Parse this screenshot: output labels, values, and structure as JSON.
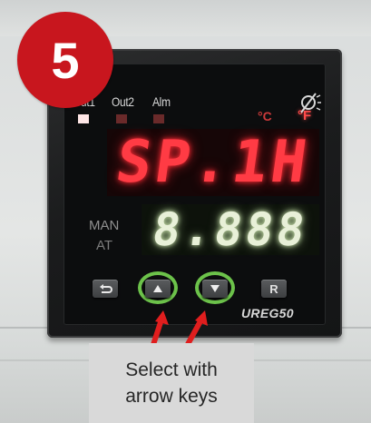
{
  "step_badge": {
    "number": "5",
    "color": "#c8161e"
  },
  "controller": {
    "indicators": [
      "Out1",
      "Out2",
      "Alm"
    ],
    "indicator_led_colors": [
      "#ffe6e6",
      "#6a2a2a",
      "#6a2a2a"
    ],
    "unit_celsius": "°C",
    "unit_fahrenheit": "°F",
    "pv_display": "SP.1H",
    "sv_display": "8.888",
    "mode_labels": {
      "man": "MAN",
      "at": "AT"
    },
    "keys": {
      "cycle_icon": "cycle-arrows-icon",
      "up_icon": "triangle-up-icon",
      "down_icon": "triangle-down-icon",
      "r_label": "R"
    },
    "brand": "UREG50",
    "logo_icon": "lightbulb-slash-icon",
    "highlight_color": "#6cc24a"
  },
  "annotation": {
    "text": "Select with\narrow keys",
    "arrow_color": "#e01e1e"
  }
}
